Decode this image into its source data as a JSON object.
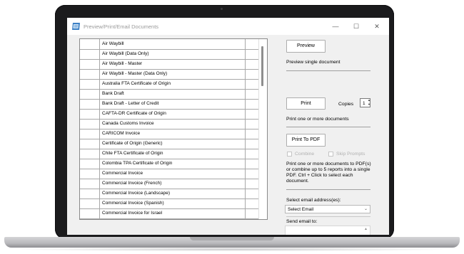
{
  "window": {
    "title": "Preview/Print/Email Documents",
    "controls": {
      "minimize": "—",
      "maximize": "☐",
      "close": "✕"
    }
  },
  "documents": [
    "Air Waybill",
    "Air Waybill  (Data Only)",
    "Air Waybill - Master",
    "Air Waybill - Master (Data Only)",
    "Australia FTA Certificate of Origin",
    "Bank Draft",
    "Bank Draft - Letter of Credit",
    "CAFTA-DR Certificate of Origin",
    "Canada Customs Invoice",
    "CARICOM Invoice",
    "Certificate of Origin (Generic)",
    "Chile FTA Certificate of Origin",
    "Colombia TPA Certificate of Origin",
    "Commercial Invoice",
    "Commercial Invoice (French)",
    "Commercial Invoice (Landscape)",
    "Commercial Invoice (Spanish)",
    "Commercial Invoice for Israel"
  ],
  "panel": {
    "preview_button": "Preview",
    "preview_desc": "Preview single document",
    "print_button": "Print",
    "copies_label": "Copies",
    "copies_value": "1",
    "print_desc": "Print one or more documents",
    "print_pdf_button": "Print To PDF",
    "combine_label": "Combine",
    "skip_prompts_label": "Skip Prompts",
    "pdf_desc_1": "Print one or more documents to PDF(s)",
    "pdf_desc_2": "or combine up to 5 reports into a single",
    "pdf_desc_3": "PDF. Ctrl + Click to select each",
    "pdf_desc_4": "document.",
    "email_select_label": "Select email address(es):",
    "email_select_value": "Select Email",
    "send_email_label": "Send email to:"
  },
  "colors": {
    "laptop_bezel": "#1b1b1d",
    "window_bg": "#f0f0f0"
  }
}
